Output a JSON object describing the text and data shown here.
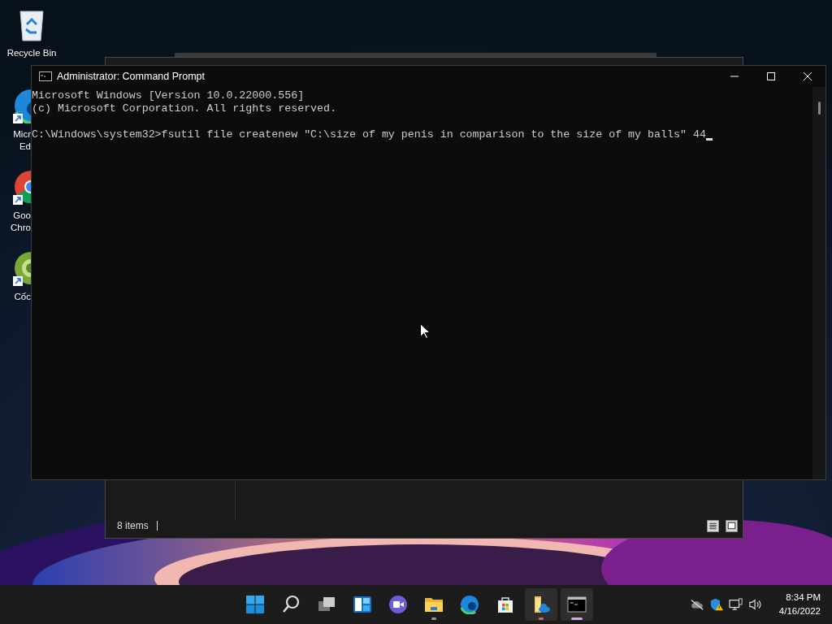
{
  "desktop_icons": [
    {
      "kind": "recycle-bin",
      "label_lines": [
        "Recycle Bin"
      ]
    },
    {
      "kind": "edge",
      "label_lines": [
        "Micr",
        "Ed"
      ]
    },
    {
      "kind": "chrome",
      "label_lines": [
        "Goo",
        "Chro"
      ]
    },
    {
      "kind": "coccoc",
      "label_lines": [
        "Cốc"
      ]
    }
  ],
  "explorer_window": {
    "status": "8 items"
  },
  "cmd_window": {
    "title": "Administrator: Command Prompt",
    "lines": [
      "Microsoft Windows [Version 10.0.22000.556]",
      "(c) Microsoft Corporation. All rights reserved."
    ],
    "prompt_line": "C:\\Windows\\system32>fsutil file createnew \"C:\\size of my penis in comparison to the size of my balls\" 44"
  },
  "taskbar": {
    "apps": [
      {
        "kind": "start",
        "running": false,
        "selected": false,
        "highlighted": false
      },
      {
        "kind": "search",
        "running": false,
        "selected": false,
        "highlighted": false
      },
      {
        "kind": "task-view",
        "running": false,
        "selected": false,
        "highlighted": false
      },
      {
        "kind": "widgets",
        "running": false,
        "selected": false,
        "highlighted": false
      },
      {
        "kind": "chat",
        "running": false,
        "selected": false,
        "highlighted": false
      },
      {
        "kind": "file-explorer",
        "running": true,
        "selected": false,
        "highlighted": false
      },
      {
        "kind": "edge",
        "running": false,
        "selected": false,
        "highlighted": false
      },
      {
        "kind": "store",
        "running": false,
        "selected": false,
        "highlighted": false
      },
      {
        "kind": "folder-cloud",
        "running": true,
        "selected": false,
        "highlighted": true
      },
      {
        "kind": "terminal",
        "running": true,
        "selected": true,
        "highlighted": false
      }
    ],
    "time": "8:34 PM",
    "date": "4/16/2022"
  }
}
